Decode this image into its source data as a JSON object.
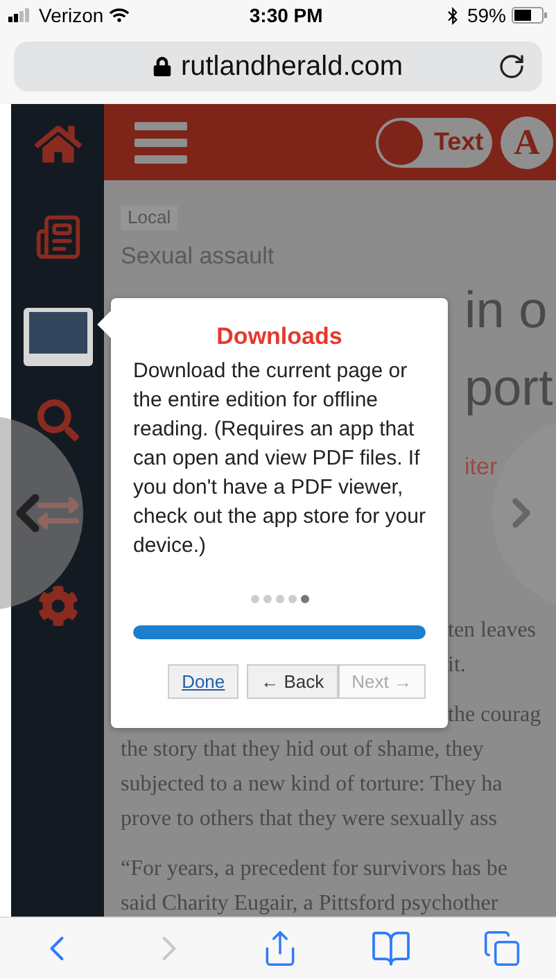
{
  "status_bar": {
    "carrier": "Verizon",
    "time": "3:30 PM",
    "battery": "59%"
  },
  "address_bar": {
    "url": "rutlandherald.com"
  },
  "sidebar": {
    "items": [
      {
        "kind": "home",
        "selected": false
      },
      {
        "kind": "newspaper",
        "selected": false
      },
      {
        "kind": "tablet",
        "selected": true
      },
      {
        "kind": "search",
        "selected": false
      },
      {
        "kind": "share",
        "selected": false
      },
      {
        "kind": "settings",
        "selected": false
      }
    ]
  },
  "header": {
    "toggle_label": "Text",
    "font_button": "A"
  },
  "article": {
    "section_tag": "Local",
    "topic": "Sexual assault",
    "lines": [
      {
        "kind": "headline",
        "text": "in o"
      },
      {
        "kind": "headline",
        "text": "port"
      },
      {
        "kind": "byline",
        "text": "iter"
      },
      {
        "kind": "body_partial",
        "text": "ten leaves"
      },
      {
        "kind": "body_partial",
        "text": "it."
      },
      {
        "kind": "paragraph_partial",
        "text": "the courag"
      },
      {
        "kind": "body",
        "text": "the story that they hid out of shame, they"
      },
      {
        "kind": "body",
        "text": "subjected to a new kind of torture: They ha"
      },
      {
        "kind": "body",
        "text": "prove to others that they were sexually ass"
      },
      {
        "kind": "paragraph",
        "text": "“For years, a precedent for survivors has be"
      },
      {
        "kind": "body",
        "text": "said Charity Eugair, a Pittsford psychother"
      }
    ]
  },
  "tour_popup": {
    "title": "Downloads",
    "body": "Download the current page or the entire edition for offline reading. (Requires an app that can open and view PDF files. If you don't have a PDF viewer, check out the app store for your device.)",
    "steps": [
      {
        "selected": false
      },
      {
        "selected": false
      },
      {
        "selected": false
      },
      {
        "selected": false
      },
      {
        "selected": true
      }
    ],
    "progress": {
      "level": 1
    },
    "buttons": [
      {
        "kind": "link",
        "label": "Done",
        "disabled": false
      },
      {
        "kind": "nav",
        "label": "← Back",
        "disabled": false
      },
      {
        "kind": "nav",
        "label": "Next →",
        "disabled": true
      }
    ]
  },
  "toolbar": {
    "items": [
      {
        "kind": "back",
        "disabled": false
      },
      {
        "kind": "forward",
        "disabled": true
      },
      {
        "kind": "share",
        "disabled": false
      },
      {
        "kind": "bookmarks",
        "disabled": false
      },
      {
        "kind": "tabs",
        "disabled": false
      }
    ]
  }
}
